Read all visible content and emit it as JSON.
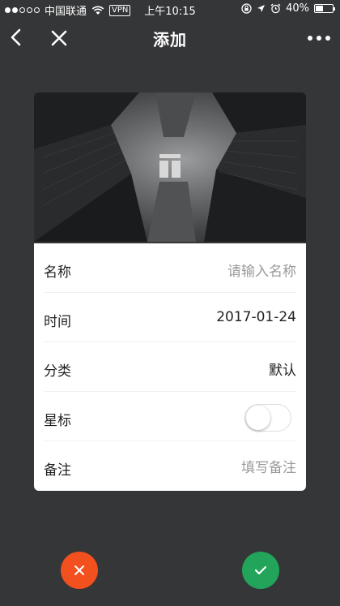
{
  "status_bar": {
    "carrier": "中国联通",
    "vpn": "VPN",
    "time": "上午10:15",
    "battery": "40%"
  },
  "nav": {
    "title": "添加"
  },
  "form": {
    "rows": [
      {
        "label": "名称",
        "value": "请输入名称",
        "is_placeholder": true
      },
      {
        "label": "时间",
        "value": "2017-01-24",
        "is_placeholder": false
      },
      {
        "label": "分类",
        "value": "默认",
        "is_placeholder": false
      },
      {
        "label": "星标",
        "toggle_on": false
      },
      {
        "label": "备注",
        "value": "填写备注",
        "is_placeholder": true
      }
    ]
  },
  "colors": {
    "background": "#353637",
    "cancel": "#f2501e",
    "confirm": "#22a55b"
  },
  "icons": {
    "back": "chevron-left-icon",
    "close": "close-icon",
    "more": "more-dots-icon",
    "cancel": "close-icon",
    "confirm": "check-icon"
  }
}
